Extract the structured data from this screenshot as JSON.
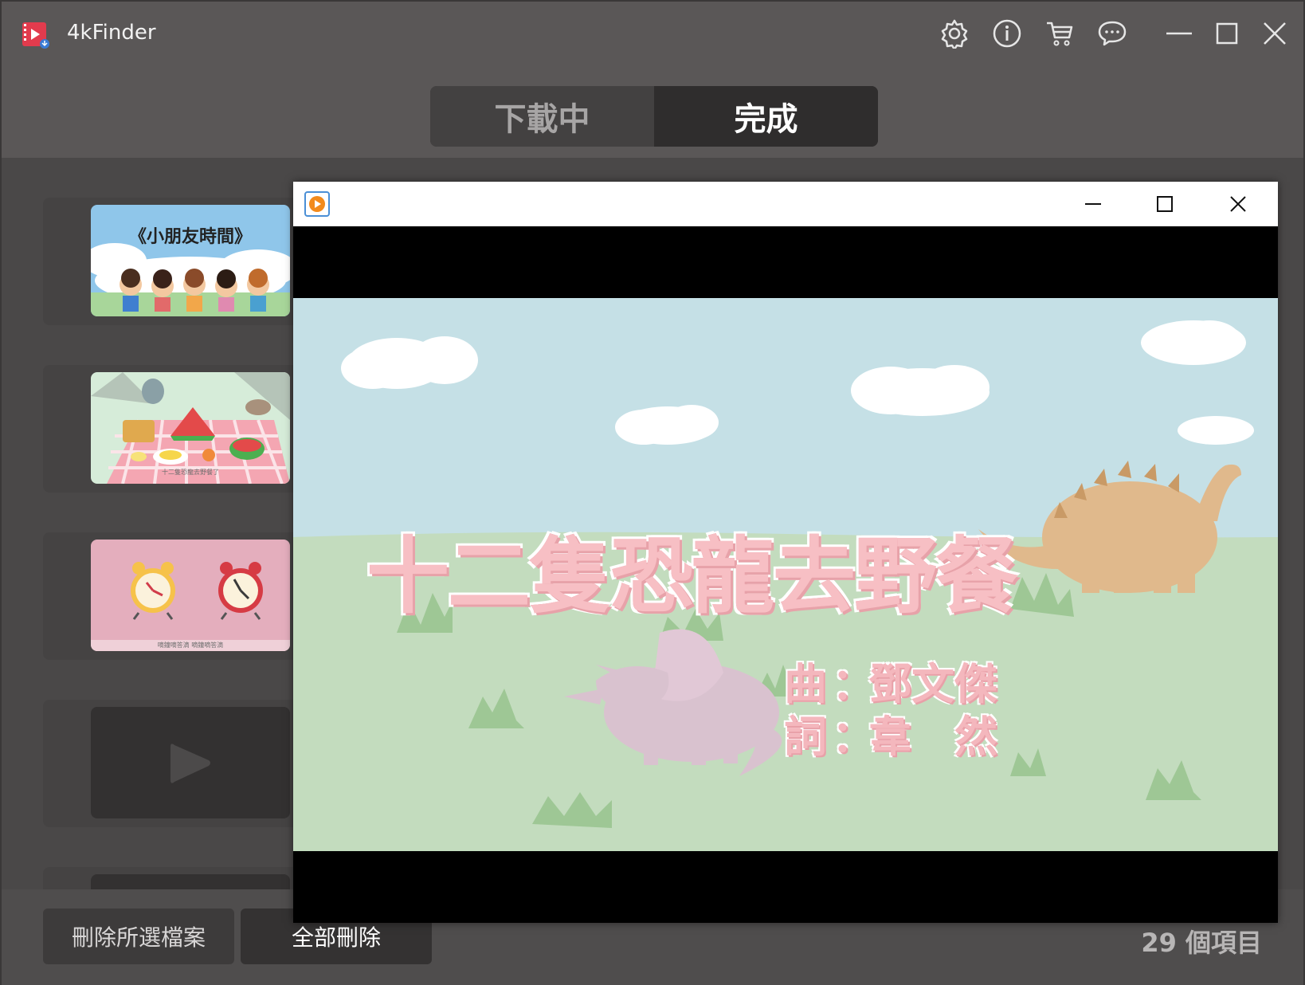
{
  "app": {
    "title": "4kFinder"
  },
  "title_icons": [
    "gear-icon",
    "info-icon",
    "cart-icon",
    "chat-icon",
    "minimize-icon",
    "maximize-icon",
    "close-icon"
  ],
  "tabs": [
    {
      "label": "下載中",
      "active": false
    },
    {
      "label": "完成",
      "active": true
    }
  ],
  "items": [
    {
      "thumb_text": "《小朋友時間》",
      "thumb": "kids-time"
    },
    {
      "thumb_text": "十二隻恐龍去野餐了",
      "thumb": "picnic"
    },
    {
      "thumb_text": "嘀鐘嘀答滴 嘀鐘嘀答滴",
      "thumb": "alarm-clocks"
    },
    {
      "thumb_text": "",
      "thumb": "play-placeholder"
    }
  ],
  "bottom": {
    "delete_selected": "刪除所選檔案",
    "delete_all": "全部刪除",
    "count": "29 個項目"
  },
  "player": {
    "video_title": "十二隻恐龍去野餐",
    "credit_music_label": "曲",
    "credit_music_name": "鄧文傑",
    "credit_lyrics_label": "詞",
    "credit_lyrics_name": "韋　然",
    "colon": "："
  },
  "colors": {
    "accent": "#e23b4d",
    "sky": "#c5e0e6",
    "grass": "#c3dcbe"
  }
}
